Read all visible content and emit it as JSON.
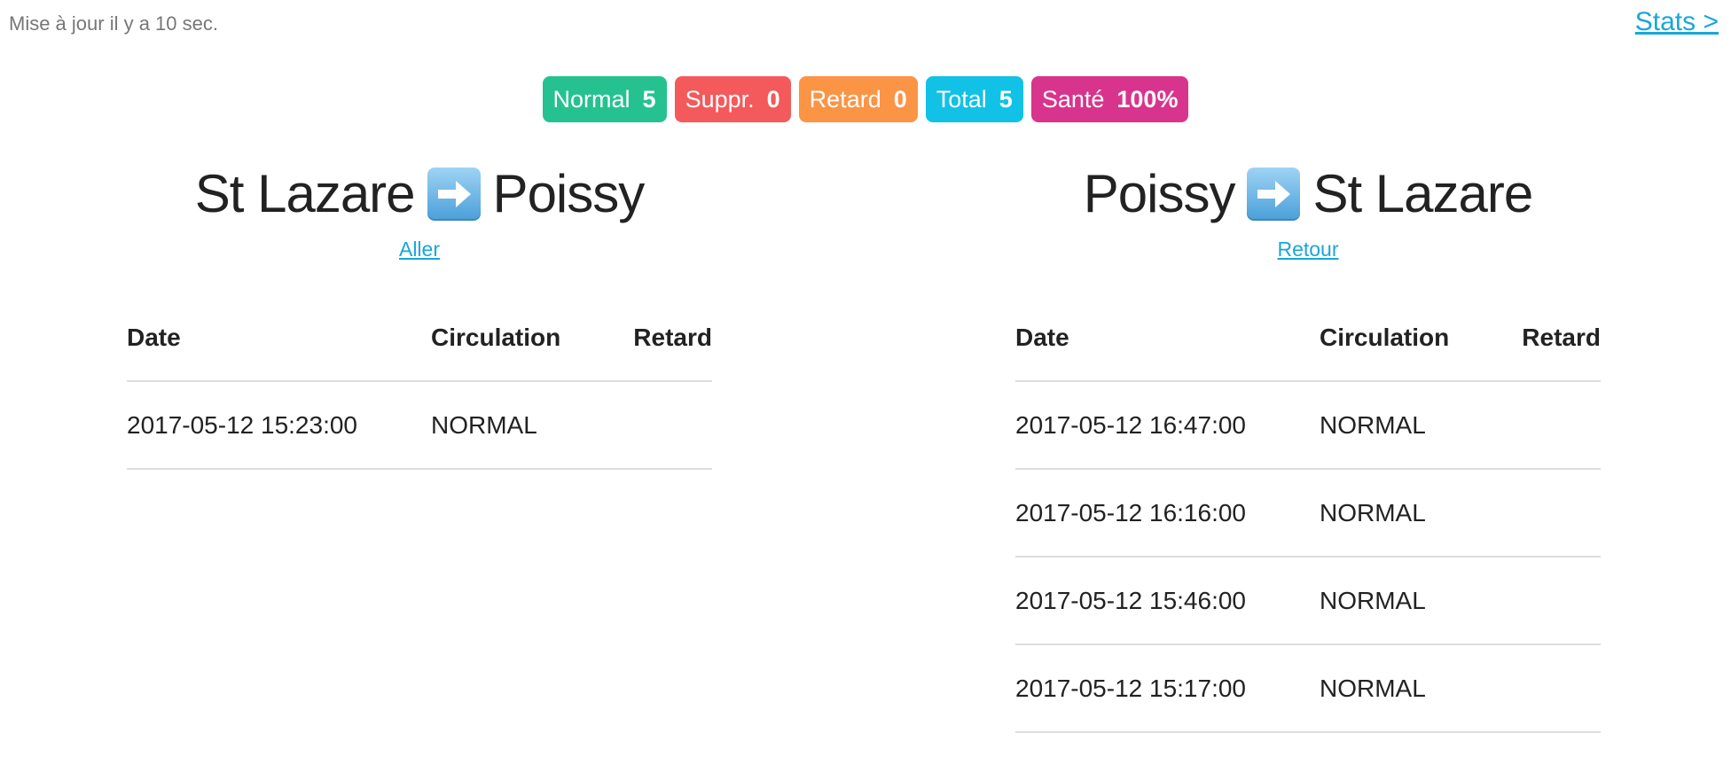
{
  "header": {
    "updated_text": "Mise à jour il y a 10 sec.",
    "stats_link": "Stats >"
  },
  "badges": [
    {
      "label": "Normal",
      "value": "5",
      "color": "#25c28f"
    },
    {
      "label": "Suppr.",
      "value": "0",
      "color": "#f4595b"
    },
    {
      "label": "Retard",
      "value": "0",
      "color": "#fb9445"
    },
    {
      "label": "Total",
      "value": "5",
      "color": "#12c1e6"
    },
    {
      "label": "Santé",
      "value": "100%",
      "color": "#d8348d"
    }
  ],
  "routes": [
    {
      "from": "St Lazare",
      "to": "Poissy",
      "arrow_icon": "right-arrow-emoji",
      "link_label": "Aller",
      "columns": [
        "Date",
        "Circulation",
        "Retard"
      ],
      "rows": [
        {
          "date": "2017-05-12 15:23:00",
          "circulation": "NORMAL",
          "retard": ""
        }
      ]
    },
    {
      "from": "Poissy",
      "to": "St Lazare",
      "arrow_icon": "right-arrow-emoji",
      "link_label": "Retour",
      "columns": [
        "Date",
        "Circulation",
        "Retard"
      ],
      "rows": [
        {
          "date": "2017-05-12 16:47:00",
          "circulation": "NORMAL",
          "retard": ""
        },
        {
          "date": "2017-05-12 16:16:00",
          "circulation": "NORMAL",
          "retard": ""
        },
        {
          "date": "2017-05-12 15:46:00",
          "circulation": "NORMAL",
          "retard": ""
        },
        {
          "date": "2017-05-12 15:17:00",
          "circulation": "NORMAL",
          "retard": ""
        }
      ]
    }
  ]
}
